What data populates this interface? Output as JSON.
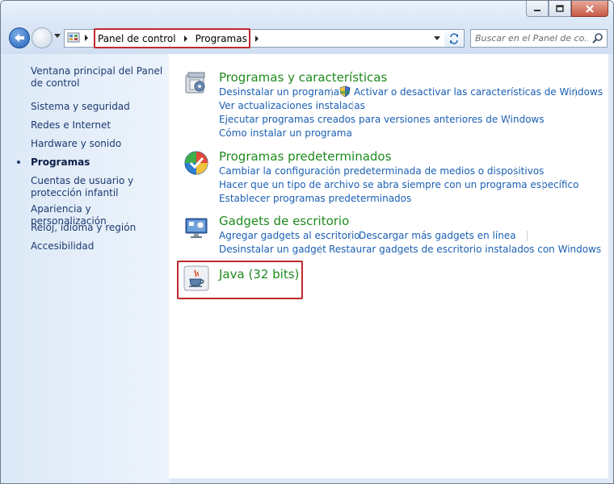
{
  "breadcrumb": [
    "Panel de control",
    "Programas"
  ],
  "search": {
    "placeholder": "Buscar en el Panel de co..."
  },
  "sidebar": {
    "home": "Ventana principal del Panel de control",
    "items": [
      "Sistema y seguridad",
      "Redes e Internet",
      "Hardware y sonido",
      "Programas",
      "Cuentas de usuario y protección infantil",
      "Apariencia y personalización",
      "Reloj, idioma y región",
      "Accesibilidad"
    ],
    "active_item": "Programas"
  },
  "categories": [
    {
      "title": "Programas y características",
      "icon": "programs-features-icon",
      "links": [
        "Desinstalar un programa",
        "Activar o desactivar las características de Windows",
        "Ver actualizaciones instaladas",
        "Ejecutar programas creados para versiones anteriores de Windows",
        "Cómo instalar un programa"
      ]
    },
    {
      "title": "Programas predeterminados",
      "icon": "default-programs-icon",
      "links": [
        "Cambiar la configuración predeterminada de medios o dispositivos",
        "Hacer que un tipo de archivo se abra siempre con un programa específico",
        "Establecer programas predeterminados"
      ]
    },
    {
      "title": "Gadgets de escritorio",
      "icon": "desktop-gadgets-icon",
      "links": [
        "Agregar gadgets al escritorio",
        "Descargar más gadgets en línea",
        "Desinstalar un gadget",
        "Restaurar gadgets de escritorio instalados con Windows"
      ]
    },
    {
      "title": "Java (32 bits)",
      "icon": "java-icon",
      "links": []
    }
  ],
  "colors": {
    "link": "#1a5fb4",
    "category_title": "#1e8a1e",
    "highlight": "#c0282d"
  }
}
